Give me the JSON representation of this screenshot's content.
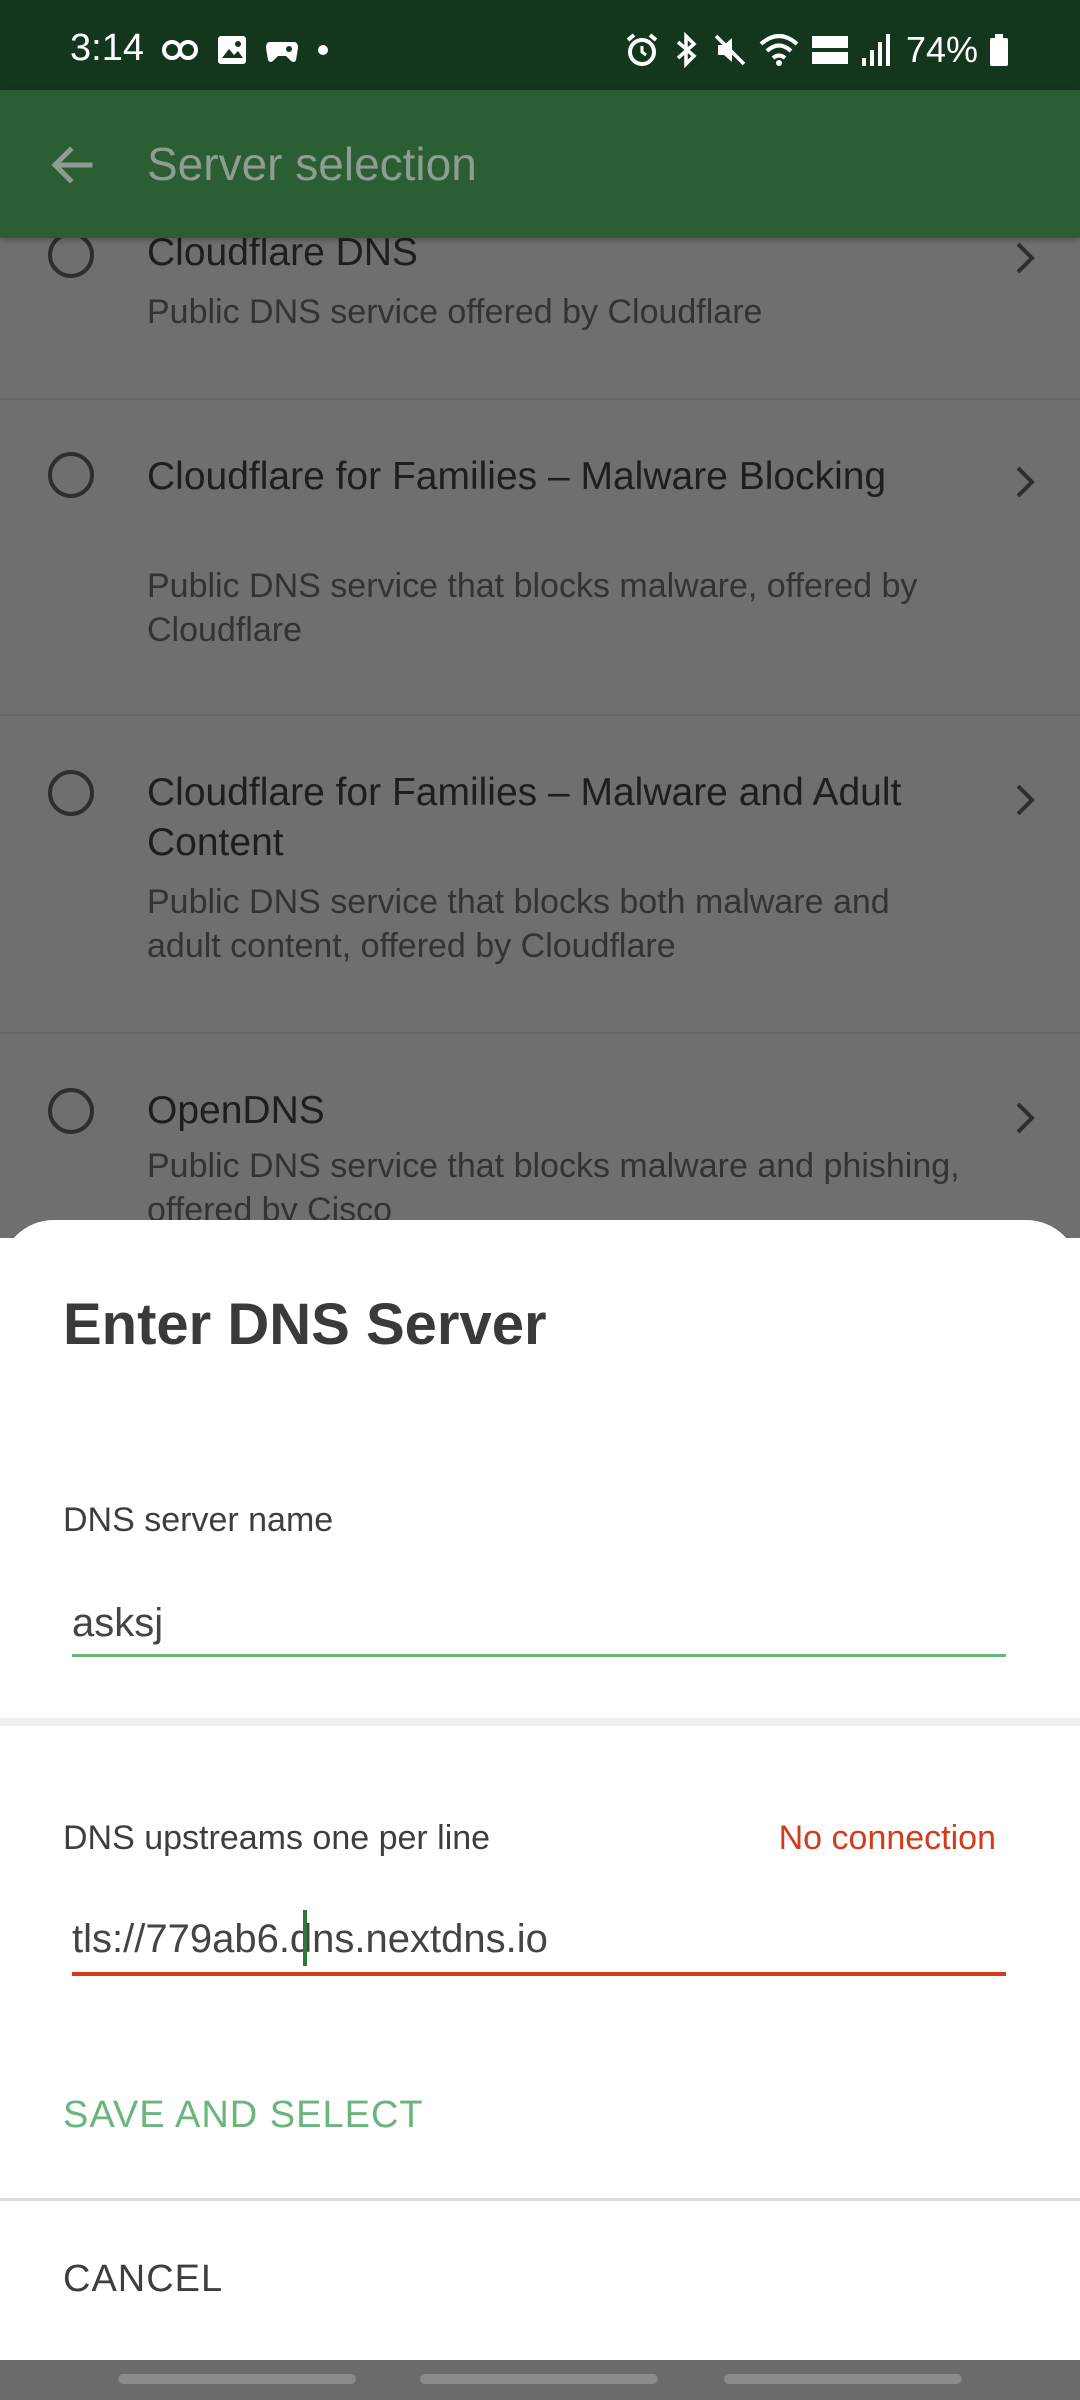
{
  "status_bar": {
    "time": "3:14",
    "battery": "74%"
  },
  "app_bar": {
    "title": "Server selection"
  },
  "servers": [
    {
      "name": "Cloudflare DNS",
      "description": "Public DNS service offered by Cloudflare"
    },
    {
      "name": "Cloudflare for Families – Malware Blocking",
      "description": "Public DNS service that blocks malware, offered by Cloudflare"
    },
    {
      "name": "Cloudflare for Families – Malware and Adult Content",
      "description": "Public DNS service that blocks both malware and adult content, offered by Cloudflare"
    },
    {
      "name": "OpenDNS",
      "description": "Public DNS service that blocks malware and phishing, offered by Cisco"
    }
  ],
  "dialog": {
    "title": "Enter DNS Server",
    "name_label": "DNS server name",
    "name_value": "asksj",
    "upstreams_label": "DNS upstreams one per line",
    "upstreams_error": "No connection",
    "upstreams_value": "tls://779ab6.dns.nextdns.io",
    "save_label": "SAVE AND SELECT",
    "cancel_label": "CANCEL"
  },
  "colors": {
    "status_bar": "#14361d",
    "app_bar": "#2b5e33",
    "accent_green": "#69b57a",
    "error_red": "#d43b1a"
  }
}
